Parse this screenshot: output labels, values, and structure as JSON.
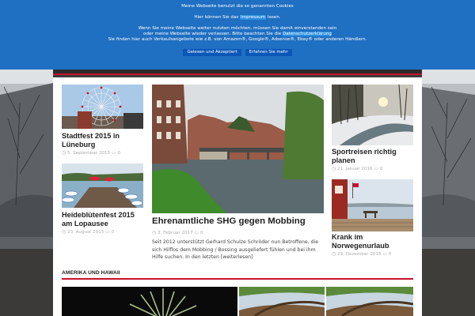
{
  "cookie_banner": {
    "line1": "Meine Webseite benutzt die so genannten Cookies",
    "line2_prefix": "Hier können Sie das ",
    "line2_link": "Impressum",
    "line2_suffix": " lesen.",
    "line3": "Wenn Sie meine Webseite weiter nutzten möchten, müssen Sie damit einverstanden sein",
    "line4_prefix": "oder meine Webseite wieder verlassen. Bitte beachten Sie die ",
    "line4_link": "Datenschutzerklärung",
    "line5": "Sie finden hier auch Verkaufsangebote wie z.B. von Amazon®, Google®, Adsense®, Ebay® oder anderen Händlern.",
    "accept_label": "Gelesen und Akzeptiert",
    "more_label": "Erfahren Sie mehr"
  },
  "posts": [
    {
      "title": "Stadtfest 2015 in Lüneburg",
      "date": "5. September 2015",
      "comments": "0"
    },
    {
      "title": "Heideblütenfest 2015 am Lopausee",
      "date": "23. August 2015",
      "comments": "0"
    },
    {
      "title": "Ehrenamtliche SHG gegen Mobbing",
      "date": "3. Februar 2017",
      "comments": "0",
      "excerpt": "Seit 2012 unterstützt Gerhard Schulze Schröder nun Betroffene, die sich Hilflos dem Mobbing / Bossing ausgeliefert fühlen und bei ihm Hilfe suchen. In den letzten",
      "more": "[weiterlesen]"
    },
    {
      "title": "Sportreisen richtig planen",
      "date": "21. Januar 2016",
      "comments": "0"
    },
    {
      "title": "Krank im Norwegenurlaub",
      "date": "29. Dezember 2015",
      "comments": "0"
    }
  ],
  "section": {
    "title": "AMERIKA UND HAWAII"
  },
  "colors": {
    "banner": "#1f6fc2",
    "accent": "#c8102e",
    "button": "#0b57b8"
  },
  "icons": {
    "date": "clock-icon",
    "comments": "comment-icon"
  }
}
